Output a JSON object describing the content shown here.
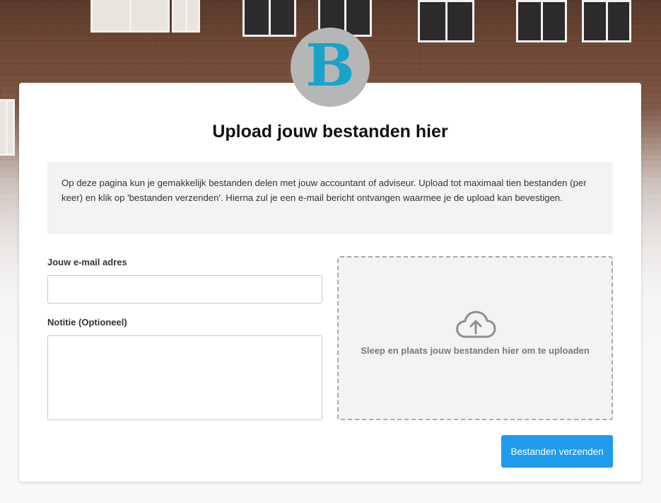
{
  "logo": {
    "letter": "B",
    "colors": {
      "background": "#b5b6b6",
      "letter": "#1aa3c9"
    }
  },
  "page": {
    "title": "Upload jouw bestanden hier",
    "intro": "Op deze pagina kun je gemakkelijk bestanden delen met jouw accountant of adviseur. Upload tot maximaal tien bestanden (per keer) en klik op 'bestanden verzenden'. Hierna zul je een e-mail bericht ontvangen waarmee je de upload kan bevestigen."
  },
  "form": {
    "email_label": "Jouw e-mail adres",
    "email_value": "",
    "note_label": "Notitie (Optioneel)",
    "note_value": ""
  },
  "dropzone": {
    "icon": "cloud-upload-icon",
    "text": "Sleep en plaats jouw bestanden hier om te uploaden"
  },
  "submit": {
    "label": "Bestanden verzenden",
    "color": "#1f9ced"
  }
}
